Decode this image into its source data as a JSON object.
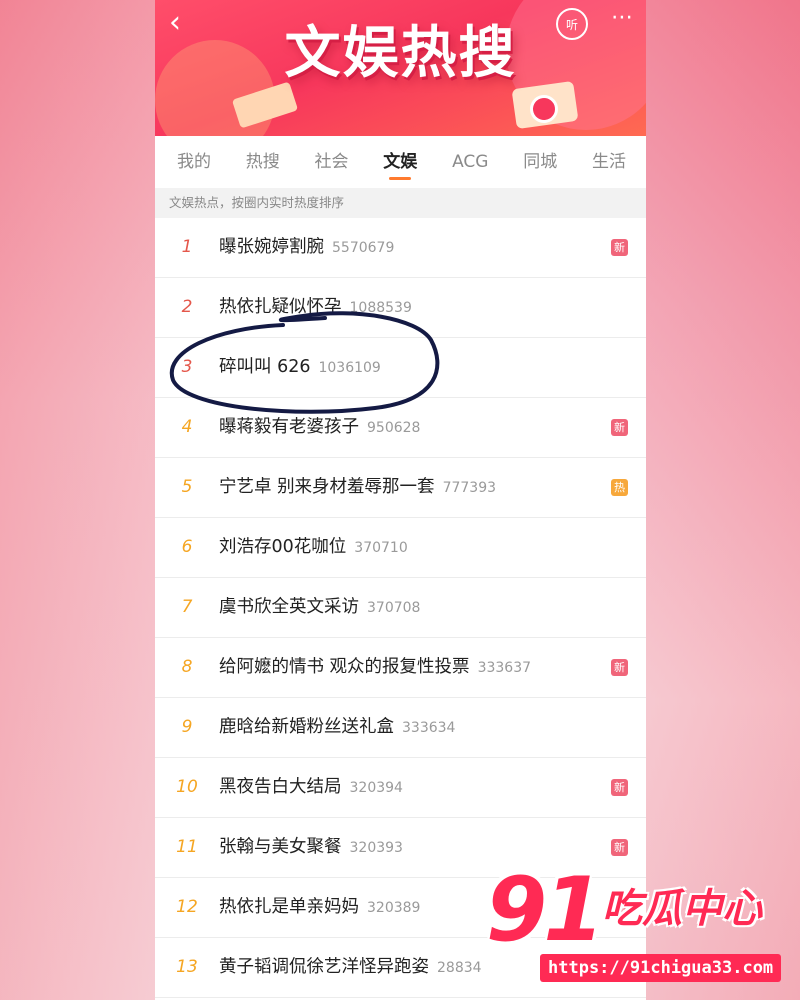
{
  "banner": {
    "title": "文娱热搜",
    "back_icon": "chevron-left-icon",
    "listen_label": "听",
    "more_icon": "more-dots-icon"
  },
  "tabs": [
    {
      "label": "我的",
      "active": false
    },
    {
      "label": "热搜",
      "active": false
    },
    {
      "label": "社会",
      "active": false
    },
    {
      "label": "文娱",
      "active": true
    },
    {
      "label": "ACG",
      "active": false
    },
    {
      "label": "同城",
      "active": false
    },
    {
      "label": "生活",
      "active": false
    }
  ],
  "subheader": "文娱热点，按圈内实时热度排序",
  "items": [
    {
      "rank": "1",
      "title": "曝张婉婷割腕",
      "heat": "5570679",
      "badge": "新"
    },
    {
      "rank": "2",
      "title": "热依扎疑似怀孕",
      "heat": "1088539",
      "badge": ""
    },
    {
      "rank": "3",
      "title": "碎叫叫 626",
      "heat": "1036109",
      "badge": ""
    },
    {
      "rank": "4",
      "title": "曝蒋毅有老婆孩子",
      "heat": "950628",
      "badge": "新"
    },
    {
      "rank": "5",
      "title": "宁艺卓 别来身材羞辱那一套",
      "heat": "777393",
      "badge": "热"
    },
    {
      "rank": "6",
      "title": "刘浩存00花咖位",
      "heat": "370710",
      "badge": ""
    },
    {
      "rank": "7",
      "title": "虞书欣全英文采访",
      "heat": "370708",
      "badge": ""
    },
    {
      "rank": "8",
      "title": "给阿嬷的情书 观众的报复性投票",
      "heat": "333637",
      "badge": "新"
    },
    {
      "rank": "9",
      "title": "鹿晗给新婚粉丝送礼盒",
      "heat": "333634",
      "badge": ""
    },
    {
      "rank": "10",
      "title": "黑夜告白大结局",
      "heat": "320394",
      "badge": "新"
    },
    {
      "rank": "11",
      "title": "张翰与美女聚餐",
      "heat": "320393",
      "badge": "新"
    },
    {
      "rank": "12",
      "title": "热依扎是单亲妈妈",
      "heat": "320389",
      "badge": "新"
    },
    {
      "rank": "13",
      "title": "黄子韬调侃徐艺洋怪异跑姿",
      "heat": "28834",
      "badge": ""
    }
  ],
  "watermark": {
    "number": "91",
    "name": "吃瓜中心",
    "url": "https://91chigua33.com"
  },
  "colors": {
    "rank_top": "#e4574b",
    "rank_rest": "#f5a623",
    "badge_new": "#f0657a",
    "badge_hot": "#f7a83b",
    "tab_indicator": "#ff7a2e",
    "watermark": "#ff2a54"
  }
}
